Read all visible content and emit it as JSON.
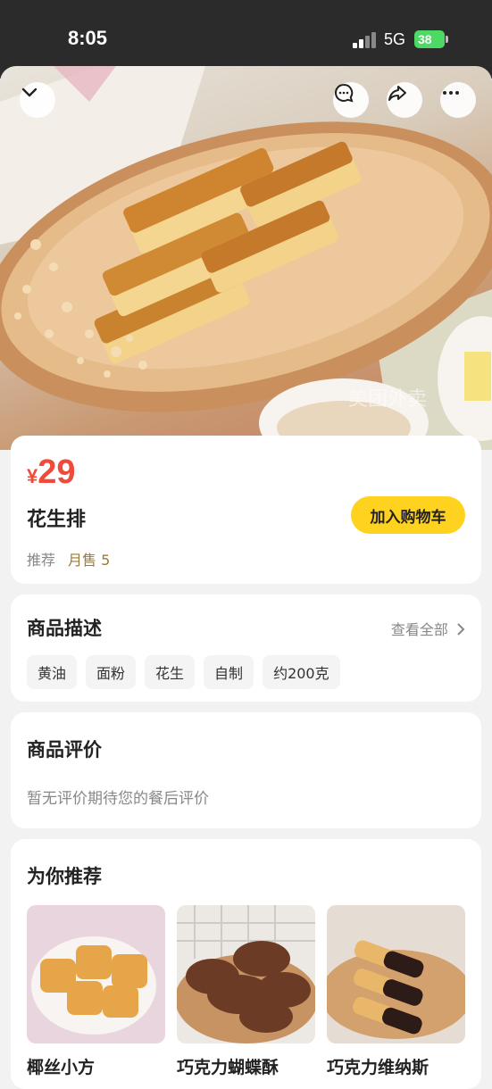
{
  "status_bar": {
    "time": "8:05",
    "network": "5G",
    "battery": "38"
  },
  "hero": {
    "icons": [
      "chevron-down-icon",
      "chat-bubble-icon",
      "share-icon",
      "more-icon"
    ],
    "watermark": "美团外卖"
  },
  "product": {
    "currency": "¥",
    "price": "29",
    "name": "花生排",
    "cart_label": "加入购物车",
    "recommend_label": "推荐",
    "sales_label": "月售 5"
  },
  "description": {
    "title": "商品描述",
    "view_all": "查看全部",
    "tags": [
      "黄油",
      "面粉",
      "花生",
      "自制",
      "约200克"
    ]
  },
  "reviews": {
    "title": "商品评价",
    "empty_text": "暂无评价期待您的餐后评价"
  },
  "recommend": {
    "title": "为你推荐",
    "items": [
      {
        "name": "椰丝小方"
      },
      {
        "name": "巧克力蝴蝶酥"
      },
      {
        "name": "巧克力维纳斯"
      }
    ]
  },
  "colors": {
    "price": "#f04a3a",
    "cart_button": "#ffd21f",
    "sales": "#9a7a3a"
  }
}
